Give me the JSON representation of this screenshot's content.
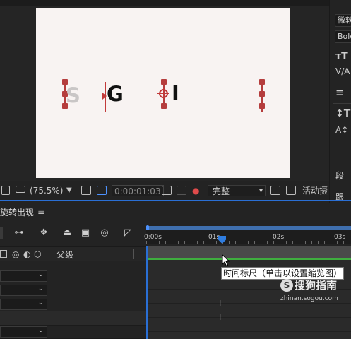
{
  "viewer": {
    "letters": [
      "S",
      "G",
      "I"
    ],
    "zoom": "(75.5%)",
    "timecode": "0:00:01:03",
    "resolution": "完整",
    "right_label": "活动摄"
  },
  "right_panel": {
    "font_family": "微软",
    "font_style": "Bold",
    "bottom_labels": [
      "段",
      "跟"
    ]
  },
  "timeline": {
    "tab_title": "旋转出现",
    "parent_column": "父级",
    "ruler_labels": [
      "0:00s",
      "01s",
      "02s",
      "03s"
    ],
    "current_time_fraction": 0.36
  },
  "tooltip": {
    "text": "时间标尺（单击以设置缩览图）"
  },
  "watermark": {
    "logo": "S",
    "brand": "搜狗指南",
    "url": "zhinan.sogou.com"
  },
  "colors": {
    "canvas_bg": "#f8f3f2",
    "handle": "#b53d3d",
    "cti_blue": "#2f7de0",
    "green_bar": "#3fae3f"
  }
}
